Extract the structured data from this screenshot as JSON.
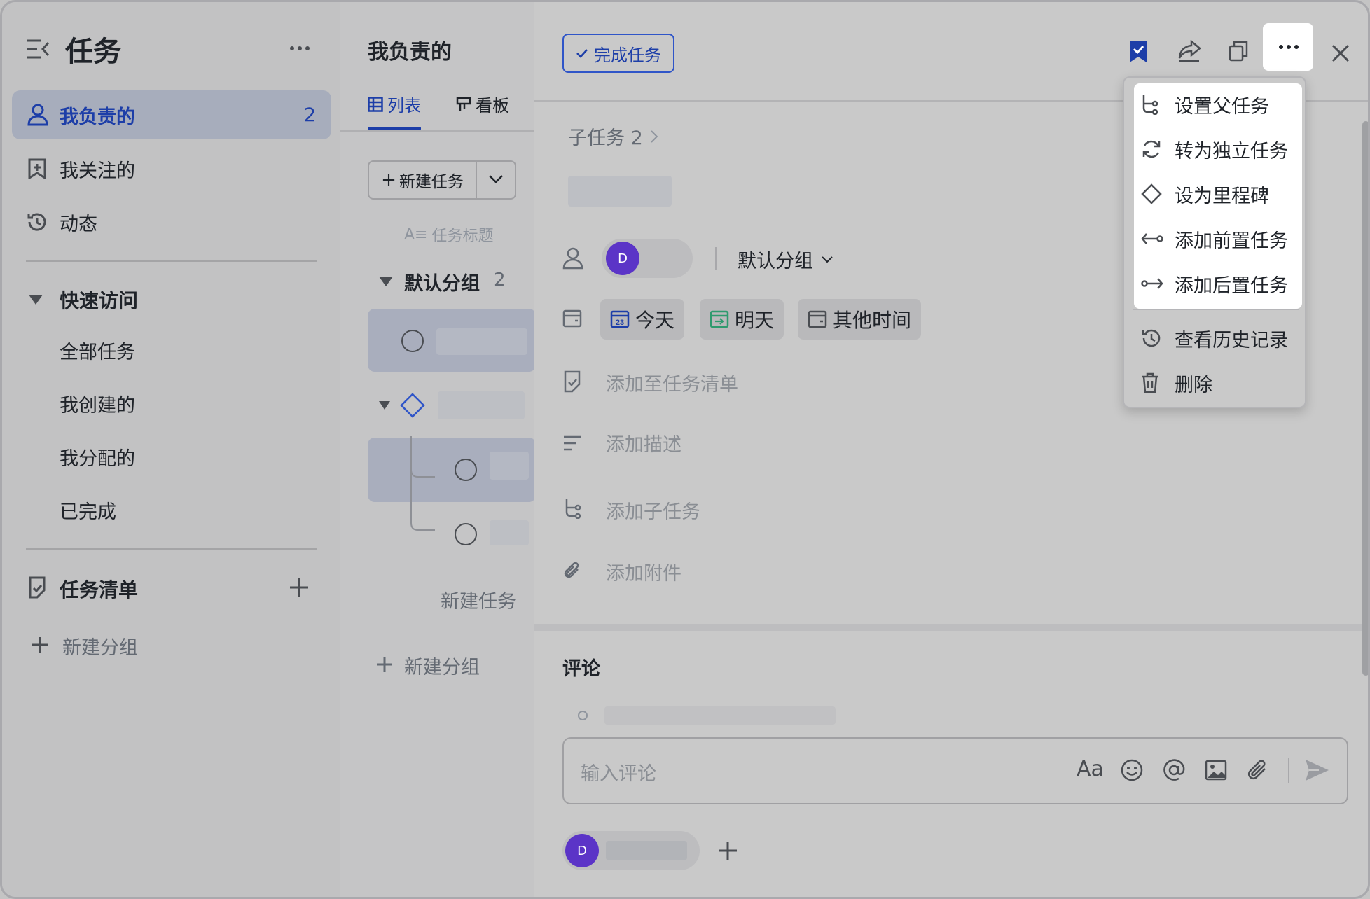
{
  "sidebar": {
    "title": "任务",
    "items": [
      {
        "label": "我负责的",
        "count": "2"
      },
      {
        "label": "我关注的"
      },
      {
        "label": "动态"
      }
    ],
    "quick_access": {
      "label": "快速访问",
      "items": [
        "全部任务",
        "我创建的",
        "我分配的",
        "已完成"
      ]
    },
    "task_lists": {
      "label": "任务清单"
    },
    "new_group": "新建分组"
  },
  "middle": {
    "title": "我负责的",
    "tabs": [
      "列表",
      "看板"
    ],
    "new_task": "新建任务",
    "column_header": "任务标题",
    "group": {
      "name": "默认分组",
      "count": "2"
    },
    "new_task_inline": "新建任务",
    "new_group": "新建分组"
  },
  "detail": {
    "complete_button": "完成任务",
    "subtask_breadcrumb": "子任务 2",
    "assignee_avatar": "D",
    "group_select": "默认分组",
    "date_chips": [
      {
        "label": "今天",
        "badge": "23"
      },
      {
        "label": "明天"
      },
      {
        "label": "其他时间"
      }
    ],
    "fields": [
      "添加至任务清单",
      "添加描述",
      "添加子任务",
      "添加附件"
    ],
    "comments_title": "评论",
    "comment_placeholder": "输入评论",
    "comment_format_icon": "Aa",
    "follower_avatar": "D"
  },
  "menu": {
    "items": [
      "设置父任务",
      "转为独立任务",
      "设为里程碑",
      "添加前置任务",
      "添加后置任务"
    ],
    "extra_items": [
      "查看历史记录",
      "删除"
    ]
  },
  "colors": {
    "accent": "#1d3ea8",
    "avatar": "#5b34c7",
    "overlay_gray": "#c8c8c8"
  }
}
